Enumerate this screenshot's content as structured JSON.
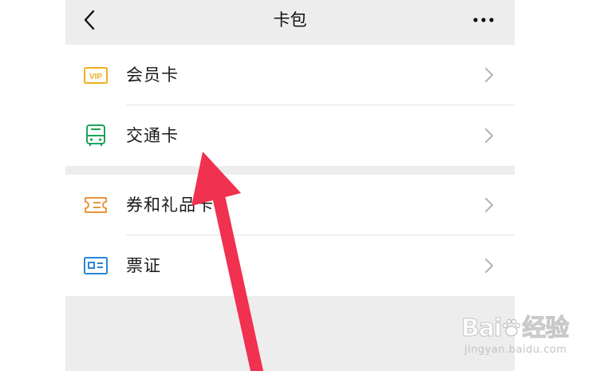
{
  "header": {
    "title": "卡包"
  },
  "groups": [
    {
      "items": [
        {
          "label": "会员卡",
          "icon": "vip-card-icon",
          "color": "#f2b01e"
        },
        {
          "label": "交通卡",
          "icon": "bus-icon",
          "color": "#1ba35b"
        }
      ]
    },
    {
      "items": [
        {
          "label": "券和礼品卡",
          "icon": "coupon-icon",
          "color": "#e8953a"
        },
        {
          "label": "票证",
          "icon": "id-card-icon",
          "color": "#2a86d8"
        }
      ]
    }
  ],
  "vip_badge": "VIP",
  "watermark": {
    "logo_left": "Bai",
    "logo_right": "经验",
    "subtitle": "jingyan.baidu.com"
  },
  "colors": {
    "header_bg": "#ededed",
    "arrow": "#f0314f"
  }
}
